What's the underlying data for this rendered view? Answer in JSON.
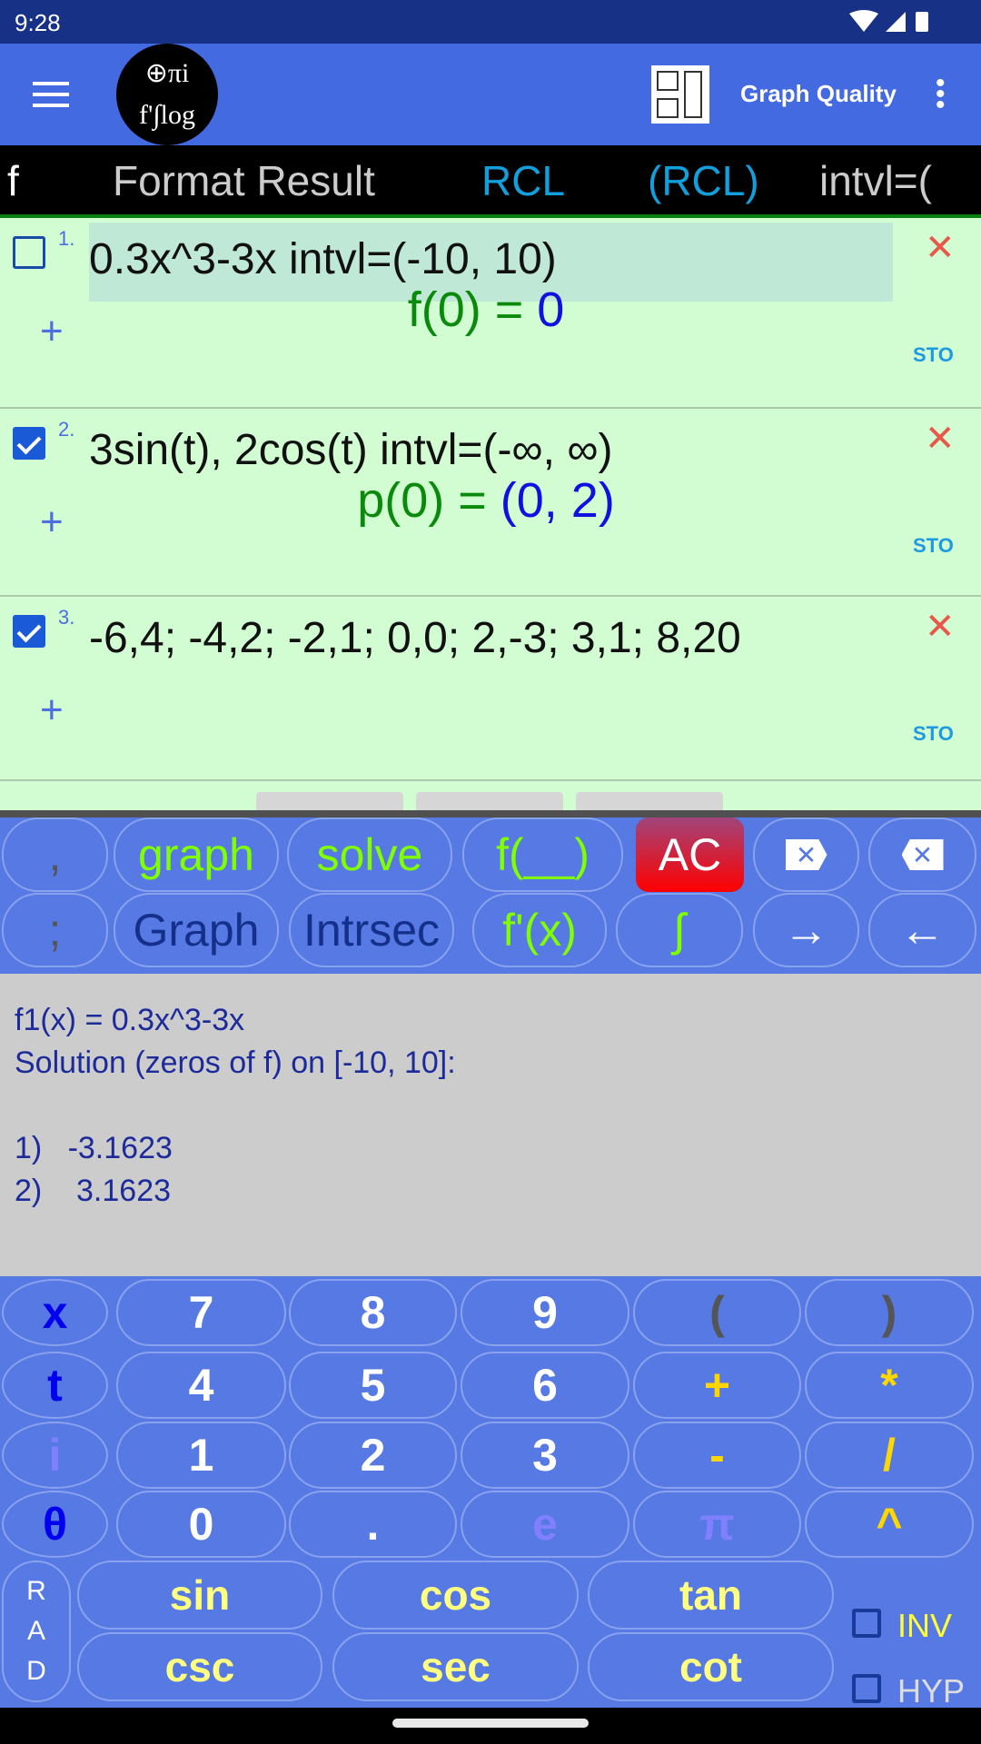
{
  "status_bar": {
    "time": "9:28",
    "icons": [
      "wifi-icon",
      "signal-icon",
      "battery-icon"
    ]
  },
  "toolbar": {
    "menu_icon": "hamburger-icon",
    "logo_text": "πi f' ∫log PRO",
    "layout_icon": "layout-icon",
    "graph_quality_label": "Graph Quality",
    "overflow_icon": "more-vert-icon"
  },
  "function_bar": {
    "items": [
      "f",
      "Format Result",
      "RCL",
      "(RCL)",
      "intvl=("
    ]
  },
  "entries": [
    {
      "number": "1.",
      "checked": false,
      "expression": "0.3x^3-3x   intvl=(-10, 10)",
      "result_label": "f(0) = ",
      "result_value": "0",
      "sto": "STO"
    },
    {
      "number": "2.",
      "checked": true,
      "expression": "3sin(t), 2cos(t)   intvl=(-∞, ∞)",
      "result_label": "p(0) = ",
      "result_value": "(0, 2)",
      "sto": "STO"
    },
    {
      "number": "3.",
      "checked": true,
      "expression": "-6,4; -4,2; -2,1; 0,0; 2,-3; 3,1; 8,20",
      "result_label": "",
      "result_value": "",
      "sto": "STO"
    }
  ],
  "keypad_top": [
    {
      "label": ",",
      "color": "#555555"
    },
    {
      "label": "graph",
      "color": "#7fff00"
    },
    {
      "label": "solve",
      "color": "#7fff00"
    },
    {
      "label": "f(__)",
      "color": "#7fff00"
    },
    {
      "label": "AC",
      "color": "#ffffff"
    },
    {
      "label": "⌫",
      "color": "#ffffff"
    },
    {
      "label": "⌦",
      "color": "#ffffff"
    },
    {
      "label": ";",
      "color": "#555555"
    },
    {
      "label": "Graph",
      "color": "#14308a"
    },
    {
      "label": "Intrsec",
      "color": "#14308a"
    },
    {
      "label": "f'(x)",
      "color": "#7fff00"
    },
    {
      "label": "∫",
      "color": "#7fff00"
    },
    {
      "label": "→",
      "color": "#ffffff"
    },
    {
      "label": "←",
      "color": "#ffffff"
    }
  ],
  "ac_colors": [
    "#a0457a",
    "#ff0000"
  ],
  "output": {
    "lines": "f1(x) = 0.3x^3-3x\nSolution (zeros of f) on [-10, 10]:\n\n1)   -3.1623\n2)    3.1623"
  },
  "keypad_main": [
    {
      "label": "x",
      "color": "#0000ee"
    },
    {
      "label": "7",
      "color": "#ffffff"
    },
    {
      "label": "8",
      "color": "#ffffff"
    },
    {
      "label": "9",
      "color": "#ffffff"
    },
    {
      "label": "(",
      "color": "#555555"
    },
    {
      "label": ")",
      "color": "#555555"
    },
    {
      "label": "t",
      "color": "#0000ee"
    },
    {
      "label": "4",
      "color": "#ffffff"
    },
    {
      "label": "5",
      "color": "#ffffff"
    },
    {
      "label": "6",
      "color": "#ffffff"
    },
    {
      "label": "+",
      "color": "#ffd700"
    },
    {
      "label": "*",
      "color": "#ffd700"
    },
    {
      "label": "i",
      "color": "#8080ff"
    },
    {
      "label": "1",
      "color": "#ffffff"
    },
    {
      "label": "2",
      "color": "#ffffff"
    },
    {
      "label": "3",
      "color": "#ffffff"
    },
    {
      "label": "-",
      "color": "#ffd700"
    },
    {
      "label": "/",
      "color": "#ffd700"
    },
    {
      "label": "θ",
      "color": "#0000ee"
    },
    {
      "label": "0",
      "color": "#ffffff"
    },
    {
      "label": ".",
      "color": "#ffffff"
    },
    {
      "label": "e",
      "color": "#8080ff"
    },
    {
      "label": "π",
      "color": "#8080ff"
    },
    {
      "label": "^",
      "color": "#ffd700"
    }
  ],
  "trig": {
    "mode": "R A D",
    "keys": [
      "sin",
      "cos",
      "tan",
      "csc",
      "sec",
      "cot"
    ],
    "inv_label": "INV",
    "hyp_label": "HYP",
    "inv_checked": false,
    "hyp_checked": false,
    "color": "#ffff80"
  }
}
